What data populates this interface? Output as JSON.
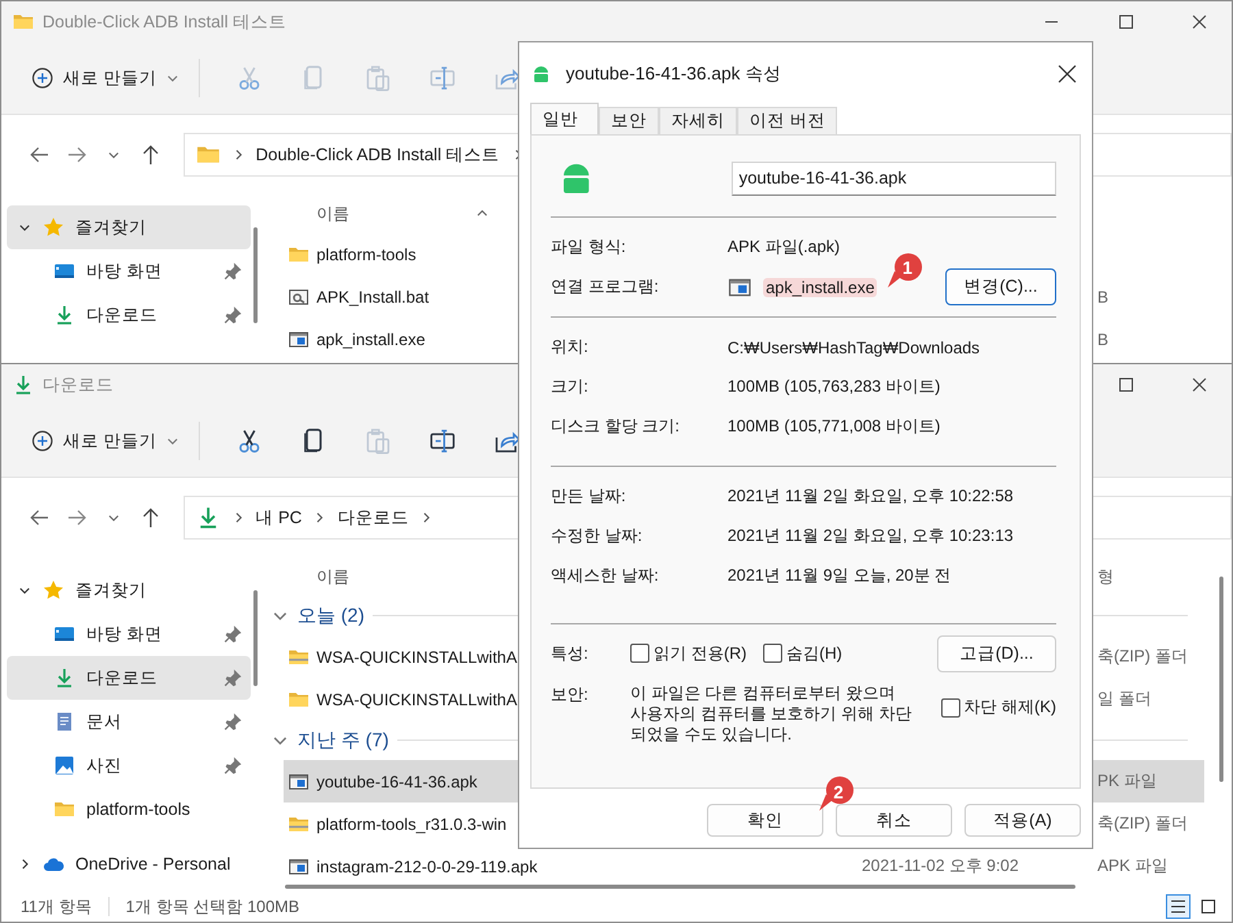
{
  "back_window": {
    "title": "Double-Click ADB Install 테스트",
    "icon": {
      "kind": "folder"
    },
    "controls": [
      {
        "kind": "minimize"
      },
      {
        "kind": "maximize"
      },
      {
        "kind": "close"
      }
    ],
    "toolbar": {
      "new_label": "새로 만들기",
      "tools": [
        {
          "kind": "cut",
          "disabled": true
        },
        {
          "kind": "copy",
          "disabled": true
        },
        {
          "kind": "paste",
          "disabled": true
        },
        {
          "kind": "rename",
          "disabled": true
        },
        {
          "kind": "share",
          "disabled": true
        }
      ]
    },
    "address": {
      "kind": "folder",
      "parts": [
        "Double-Click ADB Install 테스트"
      ]
    },
    "sidebar": [
      {
        "kind": "star",
        "label": "즐겨찾기",
        "expanded": true,
        "selected": true,
        "pinned": false
      },
      {
        "kind": "desktop",
        "label": "바탕 화면",
        "selected": false,
        "pinned": true
      },
      {
        "kind": "download",
        "label": "다운로드",
        "selected": false,
        "pinned": true
      }
    ],
    "columns": {
      "name": "이름",
      "sorted": true
    },
    "rows": [
      {
        "kind": "folder",
        "name": "platform-tools",
        "selected": false
      },
      {
        "kind": "bat",
        "name": "APK_Install.bat",
        "size": "B",
        "selected": false
      },
      {
        "kind": "exe",
        "name": "apk_install.exe",
        "size": "B",
        "selected": false
      }
    ]
  },
  "front_window": {
    "title": "다운로드",
    "icon": {
      "kind": "download"
    },
    "controls": [
      {
        "kind": "maximize"
      },
      {
        "kind": "close"
      }
    ],
    "toolbar": {
      "new_label": "새로 만들기",
      "tools": [
        {
          "kind": "cut",
          "disabled": false
        },
        {
          "kind": "copy",
          "disabled": false
        },
        {
          "kind": "paste",
          "disabled": true
        },
        {
          "kind": "rename",
          "disabled": false
        },
        {
          "kind": "share",
          "disabled": false
        }
      ]
    },
    "address": {
      "kind": "download",
      "parts": [
        "내 PC",
        "다운로드"
      ]
    },
    "sidebar": [
      {
        "kind": "star",
        "label": "즐겨찾기",
        "expanded": true,
        "selected": false,
        "pinned": false
      },
      {
        "kind": "desktop",
        "label": "바탕 화면",
        "selected": false,
        "pinned": true
      },
      {
        "kind": "download",
        "label": "다운로드",
        "selected": true,
        "pinned": true
      },
      {
        "kind": "document",
        "label": "문서",
        "selected": false,
        "pinned": true
      },
      {
        "kind": "picture",
        "label": "사진",
        "selected": false,
        "pinned": true
      },
      {
        "kind": "folder",
        "label": "platform-tools",
        "selected": false,
        "pinned": false
      },
      {
        "kind": "cloud",
        "label": "OneDrive - Personal",
        "expanded": false,
        "selected": false,
        "pinned": false
      }
    ],
    "columns": {
      "name": "이름",
      "type": "형",
      "sorted": false
    },
    "groups": [
      {
        "label": "오늘 (2)",
        "expanded": true,
        "rows": [
          {
            "kind": "zip",
            "name": "WSA-QUICKINSTALLwithA",
            "type": "축(ZIP) 폴더",
            "selected": false
          },
          {
            "kind": "folder",
            "name": "WSA-QUICKINSTALLwithA",
            "type": "일 폴더",
            "selected": false
          }
        ]
      },
      {
        "label": "지난 주 (7)",
        "expanded": true,
        "rows": [
          {
            "kind": "apk",
            "name": "youtube-16-41-36.apk",
            "type": "PK 파일",
            "selected": true
          },
          {
            "kind": "zip",
            "name": "platform-tools_r31.0.3-win",
            "type": "축(ZIP) 폴더",
            "selected": false
          },
          {
            "kind": "apk",
            "name": "instagram-212-0-0-29-119.apk",
            "date": "2021-11-02 오후 9:02",
            "type": "APK 파일",
            "selected": false
          }
        ]
      }
    ],
    "status_bar": {
      "count": "11개 항목",
      "selection": "1개 항목 선택함 100MB",
      "views": [
        {
          "kind": "details",
          "selected": true
        },
        {
          "kind": "tiles",
          "selected": false
        }
      ]
    }
  },
  "dialog": {
    "title": "youtube-16-41-36.apk 속성",
    "tabs": [
      {
        "label": "일반",
        "selected": true
      },
      {
        "label": "보안",
        "selected": false
      },
      {
        "label": "자세히",
        "selected": false
      },
      {
        "label": "이전 버전",
        "selected": false
      }
    ],
    "file_name": "youtube-16-41-36.apk",
    "sections": [
      [
        {
          "label": "파일 형식:",
          "value": "APK 파일(.apk)"
        },
        {
          "label": "연결 프로그램:",
          "value": "apk_install.exe",
          "kind": "program",
          "marker": "1",
          "button": {
            "label": "변경(C)...",
            "default": true
          }
        }
      ],
      [
        {
          "label": "위치:",
          "value": "C:₩Users₩HashTag₩Downloads"
        },
        {
          "label": "크기:",
          "value": "100MB (105,763,283 바이트)"
        },
        {
          "label": "디스크 할당 크기:",
          "value": "100MB (105,771,008 바이트)"
        }
      ],
      [
        {
          "label": "만든 날짜:",
          "value": "2021년 11월 2일 화요일, 오후 10:22:58"
        },
        {
          "label": "수정한 날짜:",
          "value": "2021년 11월 2일 화요일, 오후 10:23:13"
        },
        {
          "label": "액세스한 날짜:",
          "value": "2021년 11월 9일 오늘, 20분 전"
        }
      ]
    ],
    "attributes": {
      "label": "특성:",
      "checkboxes": [
        {
          "label": "읽기 전용(R)",
          "checked": false
        },
        {
          "label": "숨김(H)",
          "checked": false
        }
      ],
      "button": {
        "label": "고급(D)...",
        "default": false
      }
    },
    "security": {
      "label": "보안:",
      "text": "이 파일은 다른 컴퓨터로부터 왔으며 사용자의 컴퓨터를 보호하기 위해 차단 되었을 수도 있습니다.",
      "checkbox": {
        "label": "차단 해제(K)",
        "checked": false
      }
    },
    "buttons": [
      {
        "label": "확인",
        "marker": "2",
        "default": false
      },
      {
        "label": "취소",
        "default": false
      },
      {
        "label": "적용(A)",
        "default": false
      }
    ]
  }
}
